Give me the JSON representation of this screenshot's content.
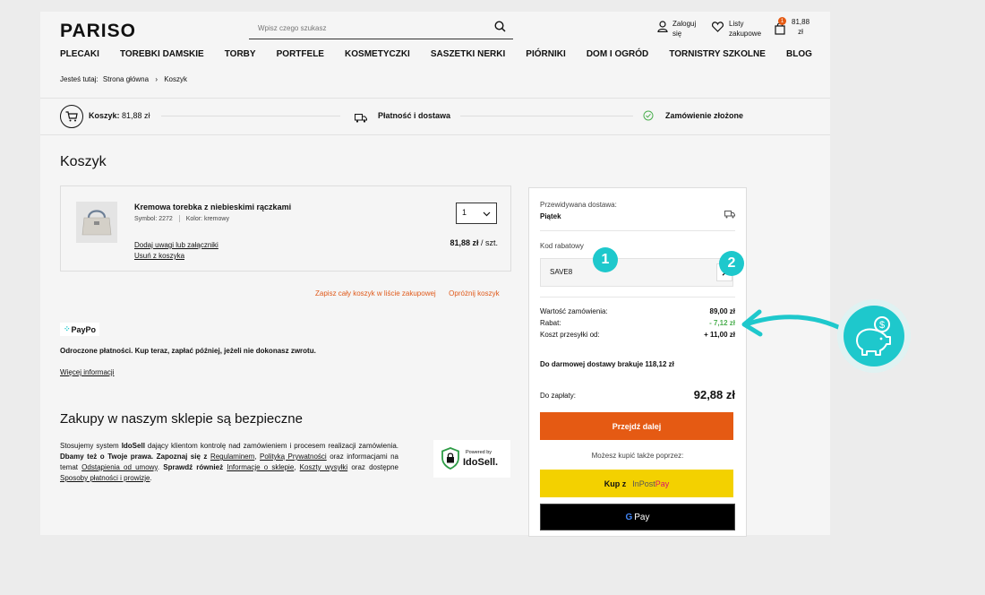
{
  "header": {
    "logo": "PARISO",
    "search_placeholder": "Wpisz czego szukasz",
    "login_line1": "Zaloguj",
    "login_line2": "się",
    "wishlist_line1": "Listy",
    "wishlist_line2": "zakupowe",
    "cart_count": "1",
    "cart_amount_line1": "81,88",
    "cart_amount_line2": "zł"
  },
  "nav": [
    "PLECAKI",
    "TOREBKI DAMSKIE",
    "TORBY",
    "PORTFELE",
    "KOSMETYCZKI",
    "SASZETKI NERKI",
    "PIÓRNIKI",
    "DOM I OGRÓD",
    "TORNISTRY SZKOLNE",
    "BLOG"
  ],
  "breadcrumb": {
    "prefix": "Jesteś tutaj:",
    "home": "Strona główna",
    "sep": "›",
    "current": "Koszyk"
  },
  "steps": {
    "cart_label": "Koszyk:",
    "cart_value": "81,88 zł",
    "payment": "Płatność i dostawa",
    "done": "Zamówienie złożone"
  },
  "cart": {
    "title": "Koszyk",
    "item": {
      "name": "Kremowa torebka z niebieskimi rączkami",
      "symbol": "Symbol: 2272",
      "color": "Kolor: kremowy",
      "add_note": "Dodaj uwagi lub załączniki",
      "remove": "Usuń z koszyka",
      "qty": "1",
      "price": "81,88 zł",
      "per_unit": "/ szt."
    },
    "save_list": "Zapisz cały koszyk w liście zakupowej",
    "empty_cart": "Opróżnij koszyk"
  },
  "paypo": {
    "logo": "PayPo",
    "text": "Odroczone płatności. Kup teraz, zapłać później, jeżeli nie dokonasz zwrotu.",
    "more": "Więcej informacji"
  },
  "safe": {
    "title": "Zakupy w naszym sklepie są bezpieczne",
    "t1": "Stosujemy system ",
    "b1": "IdoSell",
    "t2": " dający klientom kontrolę nad zamówieniem i procesem realizacji zamówienia. ",
    "b2": "Dbamy też o Twoje prawa. Zapoznaj się z ",
    "l1": "Regulaminem",
    "t3": ", ",
    "l2": "Polityką Prywatności",
    "t4": " oraz informacjami na temat ",
    "l3": "Odstąpienia od umowy",
    "t5": ". ",
    "b3": "Sprawdź również ",
    "l4": "Informacje o sklepie",
    "t6": ", ",
    "l5": "Koszty wysyłki",
    "t7": " oraz dostępne ",
    "l6": "Sposoby płatności i prowizje",
    "t8": ".",
    "badge_small": "Powered by",
    "badge_big": "IdoSell."
  },
  "summary": {
    "delivery_label": "Przewidywana dostawa:",
    "delivery_day": "Piątek",
    "coupon_label": "Kod rabatowy",
    "coupon_value": "SAVE8",
    "order_value_label": "Wartość zamówienia:",
    "order_value": "89,00 zł",
    "discount_label": "Rabat:",
    "discount": "- 7,12 zł",
    "shipping_label": "Koszt przesyłki od:",
    "shipping": "+ 11,00 zł",
    "free_shipping": "Do darmowej dostawy brakuje 118,12 zł",
    "total_label": "Do zapłaty:",
    "total": "92,88 zł",
    "proceed": "Przejdź dalej",
    "alt_pay": "Możesz kupić także poprzez:",
    "inpost_prefix": "Kup z",
    "inpost_a": "InPost",
    "inpost_b": "Pay",
    "gpay_g": "G",
    "gpay": "Pay"
  },
  "annotations": {
    "one": "1",
    "two": "2"
  },
  "colors": {
    "accent": "#e55a13",
    "teal": "#1ec8cc",
    "yellow": "#f3d100"
  }
}
